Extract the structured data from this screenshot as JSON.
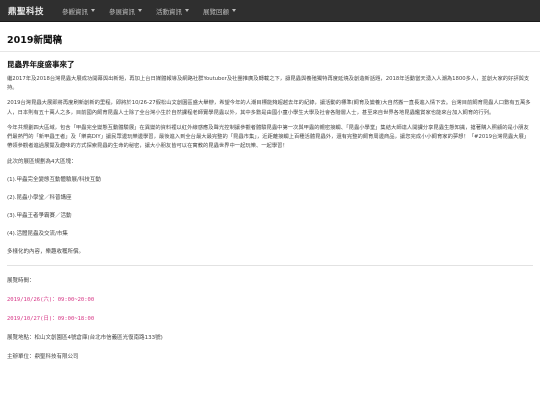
{
  "nav": {
    "brand": "鼎聖科技",
    "items": [
      {
        "label": "參觀資訊"
      },
      {
        "label": "參展資訊"
      },
      {
        "label": "活動資訊"
      },
      {
        "label": "展覽回顧"
      }
    ]
  },
  "page": {
    "title": "2019新聞稿"
  },
  "article": {
    "title": "昆蟲界年度盛事來了",
    "paragraphs": [
      "繼2017年及2018台灣昆蟲大展成功開幕與出新題，再加上台日媒體報導及網路社群Youtuber及社團推廣及轉載之下，讓昆蟲與養殖獨特再度延燒及創造新話題，2018年活動當天湧入人潮為1800多人，並創大家的好評與支持。",
      "2019台灣昆蟲大展即將再度刷新創新的里程，即將於10/26-27假松山文創園區盛大舉辦，希望今年的人潮目標能夠超越去年的紀錄，讓活動的標準(飼育及變養)大自然搬一直長進入情下去。台灣目前飼育昆蟲人口數有五萬多人，日本則有五十萬人之多，目前國內飼育昆蟲人士除了全台灣小生於自然課程老師實學昆蟲以外，其中多數是由國小童小學生大學及社會各階層人士，甚至來自世界各地昆蟲鑑賞家也能來台加入飼育的行列。",
      "今年共規劃四大區域，包含「甲蟲完全變態互動體驗展」在異變的資料裡以紅外線感應及聲光控制讓參觀者體驗昆蟲中第一次與甲蟲的親密接觸、「昆蟲小學堂」集結大師達人開課分享昆蟲生態知識，搶著購入照顧的是小朋友們最熱門的「新甲蟲王者」及「樂高DIY」讓民眾邊玩樂邊學習，最後進入到全台最大最完整的「昆蟲市集」，近距離接觸上百種活體昆蟲外，還有完整的飼育周邊商品，讓您完成小小飼育家的夢想！「#2019台灣昆蟲大展」帶領參觀者進過展覽及趣味的方式探索昆蟲的生命的秘密，讓大小朋友皆可以在寓教的昆蟲世界中一起玩樂、一起學習！"
    ],
    "areas_intro": "此次的展區規劃為4大區塊：",
    "areas": [
      "(1).甲蟲完全變態互動體驗展/科技互動",
      "(2).昆蟲小學堂／科普講座",
      "(3).甲蟲王者爭霸賽／活動",
      "(4).活體昆蟲及交流/市集"
    ],
    "closing": "多樣化的內容，樂趣收穫所償。"
  },
  "info": {
    "time_label": "展覽時間：",
    "dates": [
      "2019/10/26(六)：09:00~20:00",
      "2019/10/27(日)：09:00~18:00"
    ],
    "venue": "展覽地點：松山文創園區4號倉庫(台北市信義區光復南路133號)",
    "organizer": "主辦單位：鼎聖科技有限公司"
  },
  "colors": {
    "navbar": "#2f2f2f",
    "date_text": "#d63384"
  }
}
